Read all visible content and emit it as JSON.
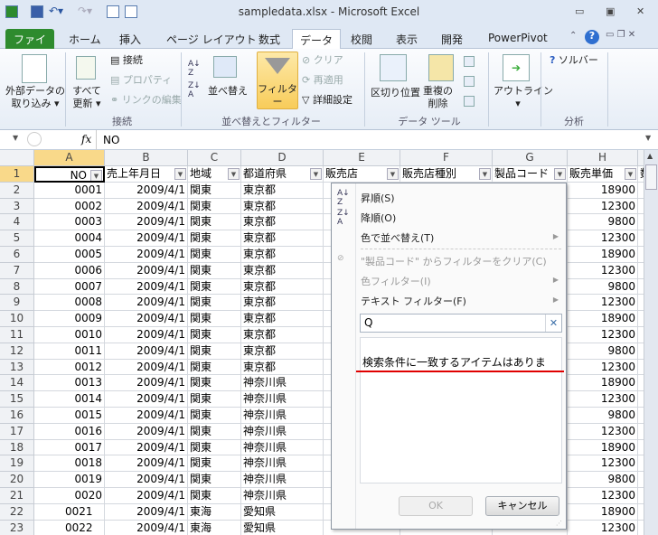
{
  "window": {
    "title": "sampledata.xlsx - Microsoft Excel",
    "controls": [
      "minimize",
      "restore",
      "close"
    ]
  },
  "tabs": [
    {
      "label": "ファイル"
    },
    {
      "label": "ホーム"
    },
    {
      "label": "挿入"
    },
    {
      "label": "ページ レイアウト"
    },
    {
      "label": "数式"
    },
    {
      "label": "データ",
      "active": true
    },
    {
      "label": "校閲"
    },
    {
      "label": "表示"
    },
    {
      "label": "開発"
    },
    {
      "label": "PowerPivot"
    }
  ],
  "ribbon": {
    "external_data": "外部データの\n取り込み ▾",
    "refresh_all": "すべて\n更新 ▾",
    "connections": "接続",
    "properties": "プロパティ",
    "edit_links": "リンクの編集",
    "group_connections": "接続",
    "sort": "並べ替え",
    "filter": "フィルター",
    "clear": "クリア",
    "reapply": "再適用",
    "advanced": "詳細設定",
    "group_sort_filter": "並べ替えとフィルター",
    "text_to_columns": "区切り位置",
    "remove_duplicates": "重複の\n削除",
    "group_data_tools": "データ ツール",
    "outline": "アウトライン\n▾",
    "solver": "ソルバー",
    "group_analysis": "分析"
  },
  "formula_bar": {
    "fx": "fx",
    "value": "NO"
  },
  "columns": [
    "A",
    "B",
    "C",
    "D",
    "E",
    "F",
    "G",
    "H"
  ],
  "headers": [
    "NO",
    "売上年月日",
    "地域",
    "都道府県",
    "販売店",
    "販売店種別",
    "製品コード",
    "販売単価",
    "数"
  ],
  "rows": [
    [
      "0001",
      "2009/4/1",
      "関東",
      "東京都",
      "18900"
    ],
    [
      "0002",
      "2009/4/1",
      "関東",
      "東京都",
      "12300"
    ],
    [
      "0003",
      "2009/4/1",
      "関東",
      "東京都",
      "9800"
    ],
    [
      "0004",
      "2009/4/1",
      "関東",
      "東京都",
      "12300"
    ],
    [
      "0005",
      "2009/4/1",
      "関東",
      "東京都",
      "18900"
    ],
    [
      "0006",
      "2009/4/1",
      "関東",
      "東京都",
      "12300"
    ],
    [
      "0007",
      "2009/4/1",
      "関東",
      "東京都",
      "9800"
    ],
    [
      "0008",
      "2009/4/1",
      "関東",
      "東京都",
      "12300"
    ],
    [
      "0009",
      "2009/4/1",
      "関東",
      "東京都",
      "18900"
    ],
    [
      "0010",
      "2009/4/1",
      "関東",
      "東京都",
      "12300"
    ],
    [
      "0011",
      "2009/4/1",
      "関東",
      "東京都",
      "9800"
    ],
    [
      "0012",
      "2009/4/1",
      "関東",
      "東京都",
      "12300"
    ],
    [
      "0013",
      "2009/4/1",
      "関東",
      "神奈川県",
      "18900"
    ],
    [
      "0014",
      "2009/4/1",
      "関東",
      "神奈川県",
      "12300"
    ],
    [
      "0015",
      "2009/4/1",
      "関東",
      "神奈川県",
      "9800"
    ],
    [
      "0016",
      "2009/4/1",
      "関東",
      "神奈川県",
      "12300"
    ],
    [
      "0017",
      "2009/4/1",
      "関東",
      "神奈川県",
      "18900"
    ],
    [
      "0018",
      "2009/4/1",
      "関東",
      "神奈川県",
      "12300"
    ],
    [
      "0019",
      "2009/4/1",
      "関東",
      "神奈川県",
      "9800"
    ],
    [
      "0020",
      "2009/4/1",
      "関東",
      "神奈川県",
      "12300"
    ],
    [
      "0021",
      "2009/4/1",
      "東海",
      "愛知県",
      "18900"
    ],
    [
      "0022",
      "2009/4/1",
      "東海",
      "愛知県",
      "12300"
    ]
  ],
  "filter_menu": {
    "sort_asc": "昇順(S)",
    "sort_desc": "降順(O)",
    "sort_color": "色で並べ替え(T)",
    "clear_filter": "\"製品コード\" からフィルターをクリア(C)",
    "color_filter": "色フィルター(I)",
    "text_filter": "テキスト フィルター(F)",
    "search_value": "Q",
    "no_match": "検索条件に一致するアイテムはありま",
    "ok": "OK",
    "cancel": "キャンセル"
  },
  "colors": {
    "file_tab": "#2e8b2e",
    "selected_header": "#f9d98a",
    "underline": "#e00000"
  }
}
